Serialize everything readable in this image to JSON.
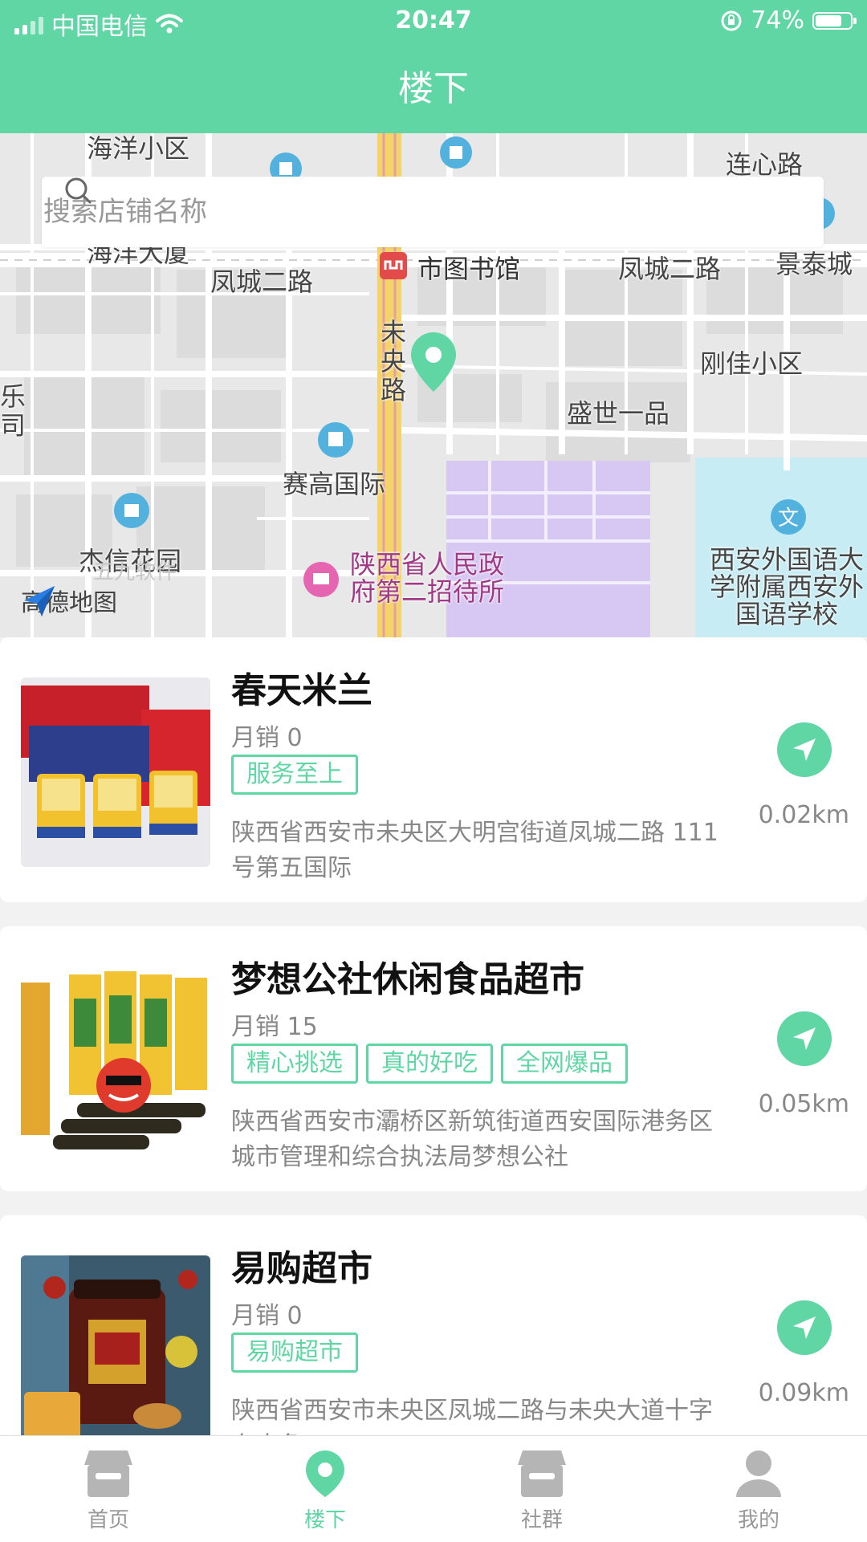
{
  "status_bar": {
    "carrier": "中国电信",
    "time": "20:47",
    "battery": "74%"
  },
  "header": {
    "title": "楼下"
  },
  "search": {
    "placeholder": "搜索店铺名称"
  },
  "map": {
    "labels": {
      "l1": "海洋小区",
      "l2": "连心路",
      "l3": "海洋大厦",
      "l4": "市图书馆",
      "l5": "凤城二路",
      "l6": "凤城二路",
      "l7": "景泰城",
      "l8": "未央路",
      "l9": "刚佳小区",
      "l10": "乐司",
      "l11": "盛世一品",
      "l12": "赛高国际",
      "l13": "杰信花园",
      "l14": "陕西省人民政府第二招待所",
      "l15": "西安外国语大学附属西安外国语学校"
    },
    "watermark": "五九软件",
    "logo_text": "高德地图"
  },
  "stores": [
    {
      "name": "春天米兰",
      "sales": "月销 0",
      "tags": [
        "服务至上"
      ],
      "address": "陕西省西安市未央区大明宫街道凤城二路 111号第五国际",
      "distance": "0.02km"
    },
    {
      "name": "梦想公社休闲食品超市",
      "sales": "月销 15",
      "tags": [
        "精心挑选",
        "真的好吃",
        "全网爆品"
      ],
      "address": "陕西省西安市灞桥区新筑街道西安国际港务区城市管理和综合执法局梦想公社",
      "distance": "0.05km"
    },
    {
      "name": "易购超市",
      "sales": "月销 0",
      "tags": [
        "易购超市"
      ],
      "address": "陕西省西安市未央区凤城二路与未央大道十字东南角",
      "distance": "0.09km"
    }
  ],
  "tabbar": {
    "home": "首页",
    "downstairs": "楼下",
    "community": "社群",
    "mine": "我的"
  },
  "colors": {
    "accent": "#5fd6a4",
    "map_bg": "#e8e8e8",
    "road": "#ffffff",
    "main_road": "#f5d36b",
    "campus": "#d7c8f3",
    "school": "#c7ecf3"
  }
}
